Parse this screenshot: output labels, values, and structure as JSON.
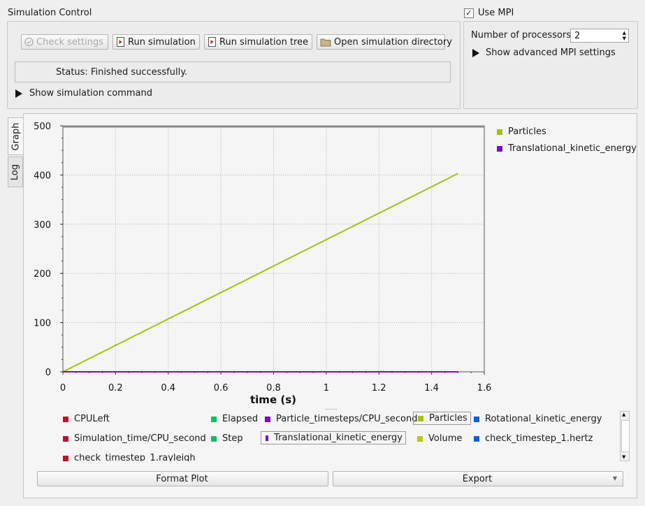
{
  "simulation_control": {
    "title": "Simulation Control",
    "buttons": {
      "check_settings": "Check settings",
      "run_simulation": "Run simulation",
      "run_simulation_tree": "Run simulation tree",
      "open_directory": "Open simulation directory"
    },
    "status_text": "Status: Finished successfully.",
    "show_command": "Show simulation command"
  },
  "mpi": {
    "use_mpi_label": "Use MPI",
    "use_mpi_checked": true,
    "processors_label": "Number of processors:",
    "processors_value": "2",
    "advanced_label": "Show advanced MPI settings"
  },
  "tabs": {
    "graph": "Graph",
    "log": "Log"
  },
  "colors": {
    "particles": "#a8bf12",
    "translational_ke": "#7b0fbf",
    "red": "#c0102a",
    "green": "#10c060",
    "blue": "#1060d0",
    "yellow": "#b8c818"
  },
  "chart_data": {
    "type": "line",
    "xlabel": "time (s)",
    "ylabel": "",
    "xlim": [
      0,
      1.6
    ],
    "ylim": [
      0,
      500
    ],
    "xticks": [
      "0",
      "0.2",
      "0.4",
      "0.6",
      "0.8",
      "1",
      "1.2",
      "1.4",
      "1.6"
    ],
    "yticks": [
      "0",
      "100",
      "200",
      "300",
      "400",
      "500"
    ],
    "grid": true,
    "legend": "right",
    "series": [
      {
        "name": "Particles",
        "x": [
          0,
          1.5
        ],
        "y": [
          0,
          403
        ]
      },
      {
        "name": "Translational_kinetic_energy",
        "x": [
          0,
          1.5
        ],
        "y": [
          0,
          0
        ]
      }
    ]
  },
  "variables": [
    {
      "label": "CPULeft",
      "color": "#c0102a"
    },
    {
      "label": "Elapsed",
      "color": "#10c060"
    },
    {
      "label": "Particle_timesteps/CPU_second",
      "color": "#7b0fbf"
    },
    {
      "label": "Particles",
      "color": "#a8bf12",
      "selected": true
    },
    {
      "label": "Rotational_kinetic_energy",
      "color": "#1060d0"
    },
    {
      "label": "Simulation_time/CPU_second",
      "color": "#c0102a"
    },
    {
      "label": "Step",
      "color": "#10c060"
    },
    {
      "label": "Translational_kinetic_energy",
      "color": "#7b0fbf",
      "selected": true
    },
    {
      "label": "Volume",
      "color": "#b8c818"
    },
    {
      "label": "check_timestep_1.hertz",
      "color": "#1060d0"
    },
    {
      "label": "check_timestep_1.rayleigh",
      "color": "#c0102a"
    }
  ],
  "bottom_buttons": {
    "format_plot": "Format Plot",
    "export": "Export"
  }
}
